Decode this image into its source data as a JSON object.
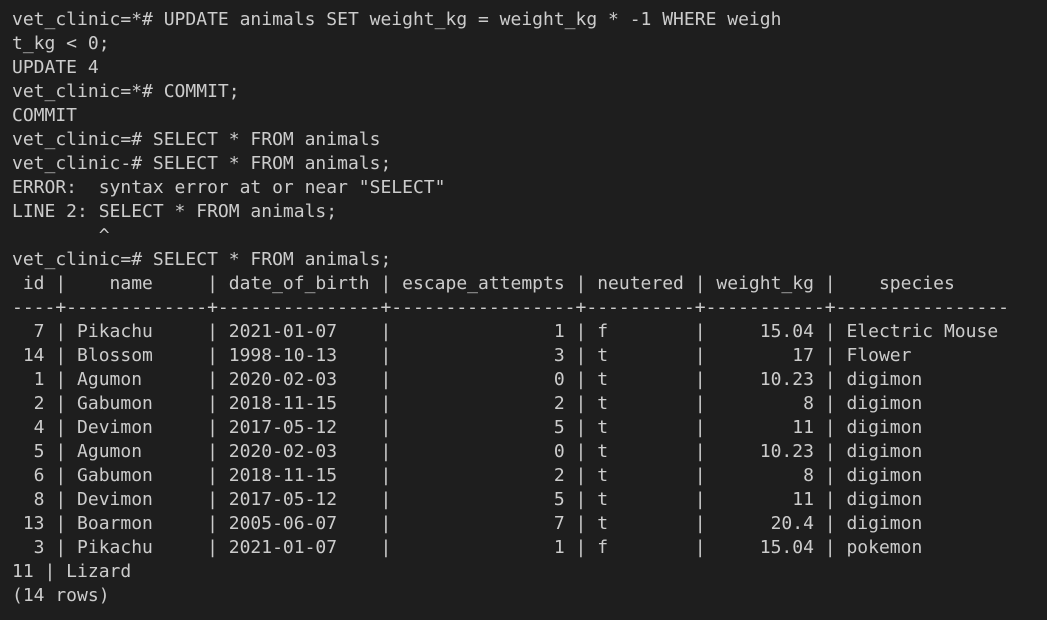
{
  "terminal": {
    "lines": [
      "vet_clinic=*# UPDATE animals SET weight_kg = weight_kg * -1 WHERE weigh",
      "t_kg < 0;",
      "UPDATE 4",
      "vet_clinic=*# COMMIT;",
      "COMMIT",
      "vet_clinic=# SELECT * FROM animals",
      "vet_clinic-# SELECT * FROM animals;",
      "ERROR:  syntax error at or near \"SELECT\"",
      "LINE 2: SELECT * FROM animals;",
      "        ^",
      "vet_clinic=# SELECT * FROM animals;",
      " id |    name     | date_of_birth | escape_attempts | neutered | weight_kg |    species",
      "----+-------------+---------------+-----------------+----------+-----------+----------------",
      "  7 | Pikachu     | 2021-01-07    |               1 | f        |     15.04 | Electric Mouse",
      " 14 | Blossom     | 1998-10-13    |               3 | t        |        17 | Flower",
      "  1 | Agumon      | 2020-02-03    |               0 | t        |     10.23 | digimon",
      "  2 | Gabumon     | 2018-11-15    |               2 | t        |         8 | digimon",
      "  4 | Devimon     | 2017-05-12    |               5 | t        |        11 | digimon",
      "  5 | Agumon      | 2020-02-03    |               0 | t        |     10.23 | digimon",
      "  6 | Gabumon     | 2018-11-15    |               2 | t        |         8 | digimon",
      "  8 | Devimon     | 2017-05-12    |               5 | t        |        11 | digimon",
      " 13 | Boarmon     | 2005-06-07    |               7 | t        |      20.4 | digimon",
      "  3 | Pikachu     | 2021-01-07    |               1 | f        |     15.04 | pokemon",
      "11 | Lizard",
      "(14 rows)"
    ]
  }
}
